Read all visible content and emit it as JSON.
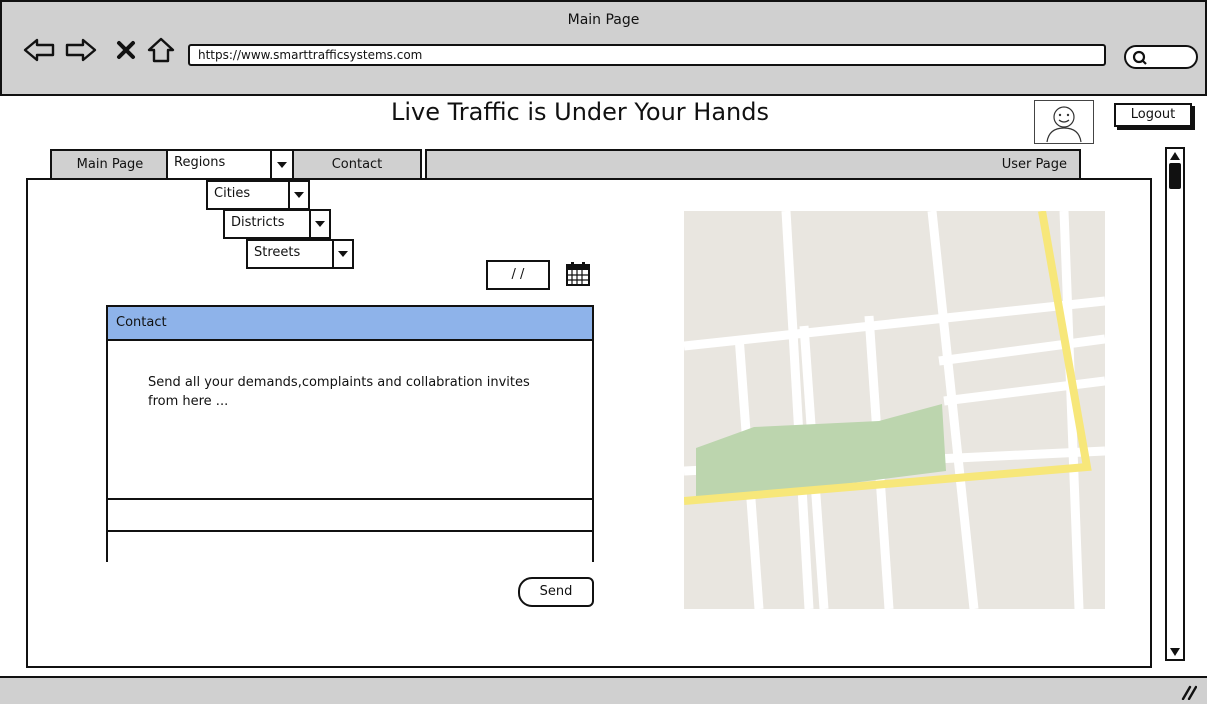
{
  "browser": {
    "window_title": "Main Page",
    "url": "https://www.smarttrafficsystems.com",
    "icons": [
      "back-arrow-icon",
      "forward-arrow-icon",
      "stop-icon",
      "home-icon",
      "search-icon"
    ]
  },
  "page": {
    "title": "Live Traffic is Under Your Hands",
    "logout_label": "Logout"
  },
  "tabs": {
    "main": "Main Page",
    "regions": "Regions",
    "contact": "Contact",
    "user": "User Page"
  },
  "dropdowns": {
    "cities": "Cities",
    "districts": "Districts",
    "streets": "Streets"
  },
  "date_field": "/ /",
  "contact": {
    "header": "Contact",
    "body": "Send all your demands,complaints and collabration invites from here ...",
    "send_label": "Send"
  },
  "colors": {
    "chrome": "#d0d0d0",
    "panel_header": "#8eb3ea",
    "map_bg": "#e9e6e0",
    "map_road": "#ffffff",
    "map_highway": "#f7e77a",
    "map_park": "#bcd5ae"
  }
}
